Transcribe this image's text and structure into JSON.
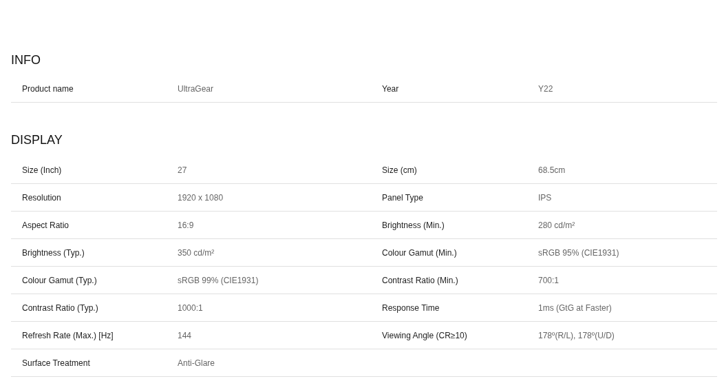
{
  "sections": [
    {
      "title": "INFO",
      "rows": [
        {
          "cells": [
            {
              "label": "Product name",
              "value": "UltraGear"
            },
            {
              "label": "Year",
              "value": "Y22"
            }
          ]
        }
      ]
    },
    {
      "title": "DISPLAY",
      "rows": [
        {
          "cells": [
            {
              "label": "Size (Inch)",
              "value": "27"
            },
            {
              "label": "Size (cm)",
              "value": "68.5cm"
            }
          ]
        },
        {
          "cells": [
            {
              "label": "Resolution",
              "value": "1920 x 1080"
            },
            {
              "label": "Panel Type",
              "value": "IPS"
            }
          ]
        },
        {
          "cells": [
            {
              "label": "Aspect Ratio",
              "value": "16:9"
            },
            {
              "label": "Brightness (Min.)",
              "value": "280 cd/m²"
            }
          ]
        },
        {
          "cells": [
            {
              "label": "Brightness (Typ.)",
              "value": "350 cd/m²"
            },
            {
              "label": "Colour Gamut (Min.)",
              "value": "sRGB 95% (CIE1931)"
            }
          ]
        },
        {
          "cells": [
            {
              "label": "Colour Gamut (Typ.)",
              "value": "sRGB 99% (CIE1931)"
            },
            {
              "label": "Contrast Ratio (Min.)",
              "value": "700:1"
            }
          ]
        },
        {
          "cells": [
            {
              "label": "Contrast Ratio (Typ.)",
              "value": "1000:1"
            },
            {
              "label": "Response Time",
              "value": "1ms (GtG at Faster)"
            }
          ]
        },
        {
          "cells": [
            {
              "label": "Refresh Rate (Max.) [Hz]",
              "value": "144"
            },
            {
              "label": "Viewing Angle (CR≥10)",
              "value": "178º(R/L), 178º(U/D)"
            }
          ]
        },
        {
          "cells": [
            {
              "label": "Surface Treatment",
              "value": "Anti-Glare"
            }
          ]
        }
      ]
    }
  ]
}
